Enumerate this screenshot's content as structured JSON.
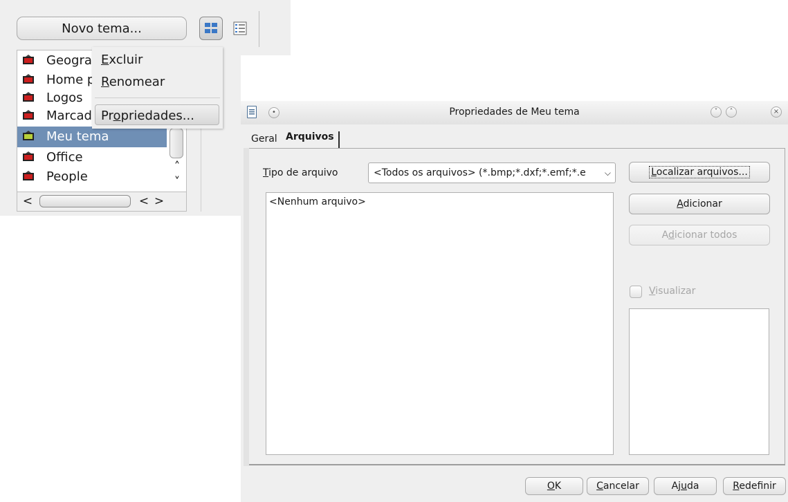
{
  "gallery": {
    "new_theme_button": "Novo tema...",
    "themes": [
      {
        "label": "Geogra",
        "selected": false
      },
      {
        "label": "Home p",
        "selected": false
      },
      {
        "label": "Logos",
        "selected": false
      },
      {
        "label": "Marcadores",
        "selected": false
      },
      {
        "label": "Meu tema",
        "selected": true
      },
      {
        "label": "Office",
        "selected": false
      },
      {
        "label": "People",
        "selected": false
      }
    ],
    "context_menu": {
      "delete": {
        "accel": "E",
        "rest": "xcluir"
      },
      "rename": {
        "accel": "R",
        "rest": "enomear"
      },
      "properties": {
        "before": "Pr",
        "accel": "o",
        "after": "priedades..."
      }
    }
  },
  "dialog": {
    "title": "Propriedades de Meu tema",
    "tabs": {
      "general": "Geral",
      "files": "Arquivos"
    },
    "file_type": {
      "label_accel": "T",
      "label_rest": "ipo de arquivo",
      "value": "<Todos os arquivos> (*.bmp;*.dxf;*.emf;*.e"
    },
    "file_list_empty": "<Nenhum arquivo>",
    "buttons": {
      "find": {
        "accel": "L",
        "rest": "ocalizar arquivos..."
      },
      "add": {
        "accel": "A",
        "rest": "dicionar"
      },
      "add_all": {
        "before": "A",
        "accel": "d",
        "after": "icionar todos"
      },
      "ok": {
        "accel": "O",
        "rest": "K"
      },
      "cancel": {
        "accel": "C",
        "rest": "ancelar"
      },
      "help": {
        "before": "Aj",
        "accel": "u",
        "after": "da"
      },
      "reset": {
        "accel": "R",
        "rest": "edefinir"
      }
    },
    "preview": {
      "accel": "V",
      "rest": "isualizar",
      "checked": false
    }
  },
  "colors": {
    "selection": "#6f8fb5",
    "theme_icon_red": "#cc1f1f",
    "theme_icon_green": "#b8d03a",
    "window_bg": "#efefef"
  }
}
